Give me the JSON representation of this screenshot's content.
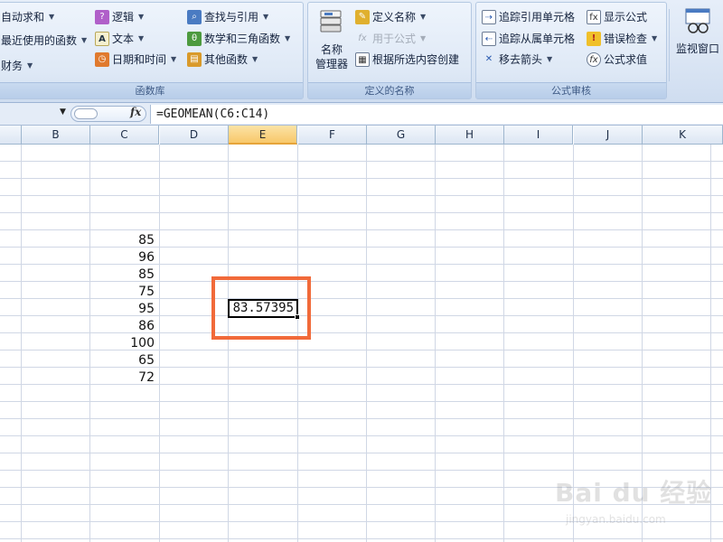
{
  "ribbon": {
    "function_library": {
      "label": "函数库",
      "col1": [
        {
          "label": "自动求和",
          "icon": "sum-icon"
        },
        {
          "label": "最近使用的函数",
          "icon": "recent-functions-icon"
        },
        {
          "label": "财务",
          "icon": "finance-icon"
        }
      ],
      "col2": [
        {
          "label": "逻辑",
          "icon": "logical-icon"
        },
        {
          "label": "文本",
          "icon": "text-icon"
        },
        {
          "label": "日期和时间",
          "icon": "date-time-icon"
        }
      ],
      "col3": [
        {
          "label": "查找与引用",
          "icon": "lookup-icon"
        },
        {
          "label": "数学和三角函数",
          "icon": "math-trig-icon"
        },
        {
          "label": "其他函数",
          "icon": "more-functions-icon"
        }
      ]
    },
    "defined_names": {
      "label": "定义的名称",
      "name_manager_line1": "名称",
      "name_manager_line2": "管理器",
      "items": [
        {
          "label": "定义名称",
          "icon": "define-name-icon"
        },
        {
          "label": "用于公式",
          "icon": "use-in-formula-icon"
        },
        {
          "label": "根据所选内容创建",
          "icon": "create-from-selection-icon"
        }
      ]
    },
    "formula_auditing": {
      "label": "公式审核",
      "col1": [
        {
          "label": "追踪引用单元格",
          "icon": "trace-precedents-icon"
        },
        {
          "label": "追踪从属单元格",
          "icon": "trace-dependents-icon"
        },
        {
          "label": "移去箭头",
          "icon": "remove-arrows-icon"
        }
      ],
      "col2": [
        {
          "label": "显示公式",
          "icon": "show-formulas-icon"
        },
        {
          "label": "错误检查",
          "icon": "error-check-icon"
        },
        {
          "label": "公式求值",
          "icon": "evaluate-formula-icon"
        }
      ],
      "watch_window": "监视窗口"
    }
  },
  "formula_bar": {
    "fx": "fx",
    "formula": "=GEOMEAN(C6:C14)"
  },
  "columns": [
    "B",
    "C",
    "D",
    "E",
    "F",
    "G",
    "H",
    "I",
    "J",
    "K"
  ],
  "active_column": "E",
  "c_values": [
    "85",
    "96",
    "85",
    "75",
    "95",
    "86",
    "100",
    "65",
    "72"
  ],
  "result": "83.57395",
  "watermark": {
    "main": "Bai du 经验",
    "sub": "jingyan.baidu.com"
  }
}
